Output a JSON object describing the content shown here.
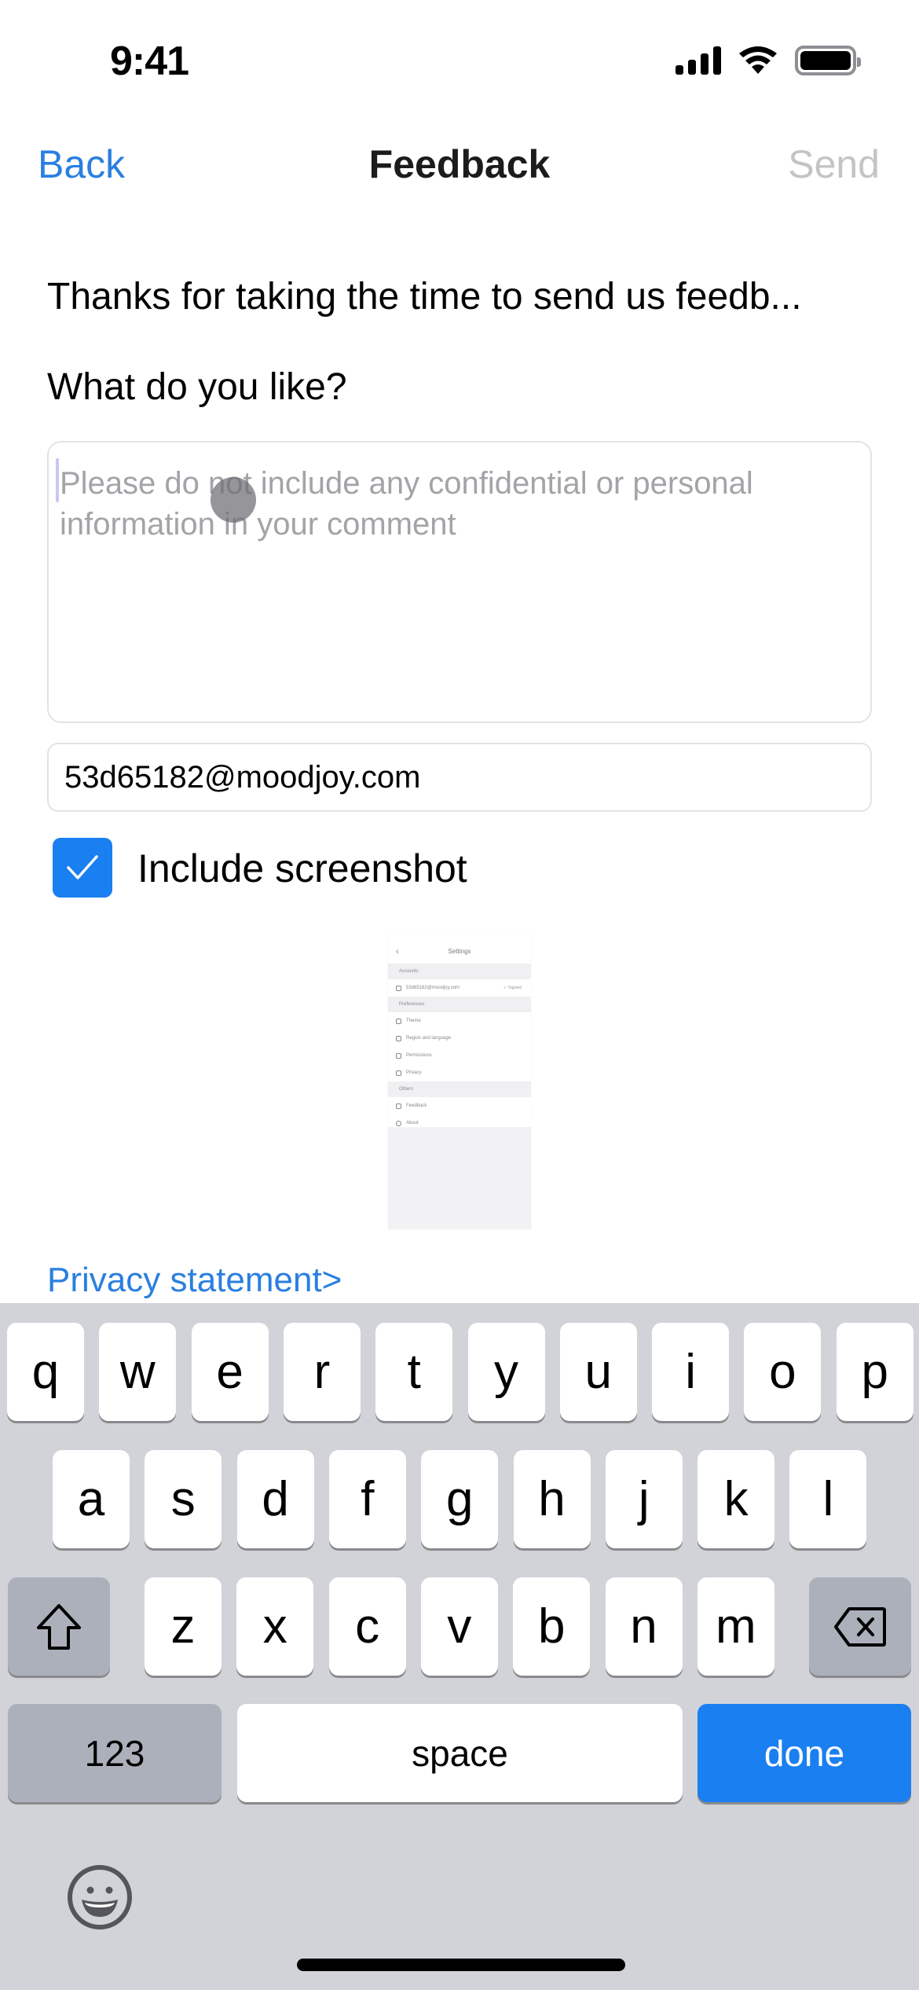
{
  "status_bar": {
    "time": "9:41",
    "icons": [
      "cellular-signal-icon",
      "wifi-icon",
      "battery-icon"
    ]
  },
  "nav": {
    "back_label": "Back",
    "title": "Feedback",
    "send_label": "Send"
  },
  "form": {
    "intro": "Thanks for taking the time to send us feedb...",
    "question": "What do you like?",
    "comment_value": "",
    "comment_placeholder": "Please do not include any confidential or personal information in your comment",
    "email_value": "53d65182@moodjoy.com",
    "include_screenshot_label": "Include screenshot",
    "include_screenshot_checked": true,
    "privacy_link": "Privacy statement>"
  },
  "screenshot_preview": {
    "title": "Settings",
    "sections": [
      {
        "header": "Accounts",
        "rows": [
          {
            "icon": "user-icon",
            "label": "53d65182@moodjoy.com",
            "right": "✓ Signed"
          }
        ]
      },
      {
        "header": "Preferences",
        "rows": [
          {
            "icon": "theme-icon",
            "label": "Theme"
          },
          {
            "icon": "globe-icon",
            "label": "Region and language"
          },
          {
            "icon": "lock-icon",
            "label": "Permissions"
          },
          {
            "icon": "shield-icon",
            "label": "Privacy"
          }
        ]
      },
      {
        "header": "Others",
        "rows": [
          {
            "icon": "feedback-icon",
            "label": "Feedback"
          },
          {
            "icon": "info-icon",
            "label": "About"
          }
        ]
      }
    ]
  },
  "keyboard": {
    "row1": [
      "q",
      "w",
      "e",
      "r",
      "t",
      "y",
      "u",
      "i",
      "o",
      "p"
    ],
    "row2": [
      "a",
      "s",
      "d",
      "f",
      "g",
      "h",
      "j",
      "k",
      "l"
    ],
    "row3": [
      "z",
      "x",
      "c",
      "v",
      "b",
      "n",
      "m"
    ],
    "numbers_label": "123",
    "space_label": "space",
    "done_label": "done"
  },
  "colors": {
    "accent": "#2a7fe0",
    "keyboard_bg": "#d1d3d9",
    "done_key": "#1a7ff0",
    "disabled_text": "#c4c4c6"
  }
}
